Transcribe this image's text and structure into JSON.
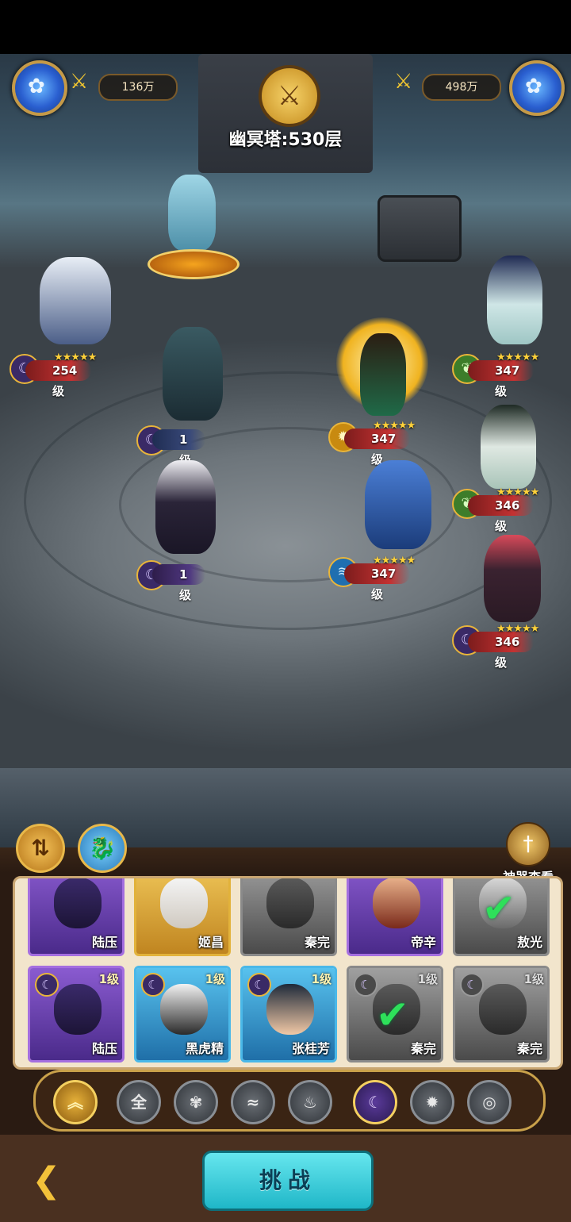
{
  "hud": {
    "left_power": "136万",
    "right_power": "498万",
    "tower_label": "幽冥塔:530层",
    "center_icon": "crossed-swords-icon",
    "orb_icon": "crystal-flower-icon"
  },
  "left_team": [
    {
      "level": "254级",
      "stars": "★★★★★",
      "element": "moon"
    },
    {
      "level": "1级",
      "stars": "",
      "element": "moon"
    },
    {
      "level": "1级",
      "stars": "",
      "element": "moon"
    }
  ],
  "right_team": [
    {
      "level": "347级",
      "stars": "★★★★★",
      "element": "gold"
    },
    {
      "level": "347级",
      "stars": "★★★★★",
      "element": "green"
    },
    {
      "level": "347级",
      "stars": "★★★★★",
      "element": "water"
    },
    {
      "level": "346级",
      "stars": "★★★★★",
      "element": "green"
    },
    {
      "level": "346级",
      "stars": "★★★★★",
      "element": "moon"
    }
  ],
  "toolbar": {
    "artifact_label": "神器查看",
    "swap_icon": "swap-arrows-icon",
    "pet_icon": "dragon-pet-icon"
  },
  "roster_top": [
    {
      "name": "陆压",
      "rarity": "purple",
      "checked": false
    },
    {
      "name": "姬昌",
      "rarity": "gold",
      "checked": false
    },
    {
      "name": "秦完",
      "rarity": "grey",
      "checked": false
    },
    {
      "name": "帝辛",
      "rarity": "purple",
      "checked": false
    },
    {
      "name": "敖光",
      "rarity": "grey",
      "checked": true
    }
  ],
  "roster_bottom": [
    {
      "name": "陆压",
      "level": "1级",
      "rarity": "purple",
      "checked": false
    },
    {
      "name": "黑虎精",
      "level": "1级",
      "rarity": "blue",
      "checked": false
    },
    {
      "name": "张桂芳",
      "level": "1级",
      "rarity": "blue",
      "checked": false
    },
    {
      "name": "秦完",
      "level": "1级",
      "rarity": "grey",
      "checked": true
    },
    {
      "name": "秦完",
      "level": "1级",
      "rarity": "grey",
      "checked": false
    }
  ],
  "filters": {
    "all_label": "全",
    "selected": "moon"
  },
  "actions": {
    "challenge_label": "挑战"
  }
}
